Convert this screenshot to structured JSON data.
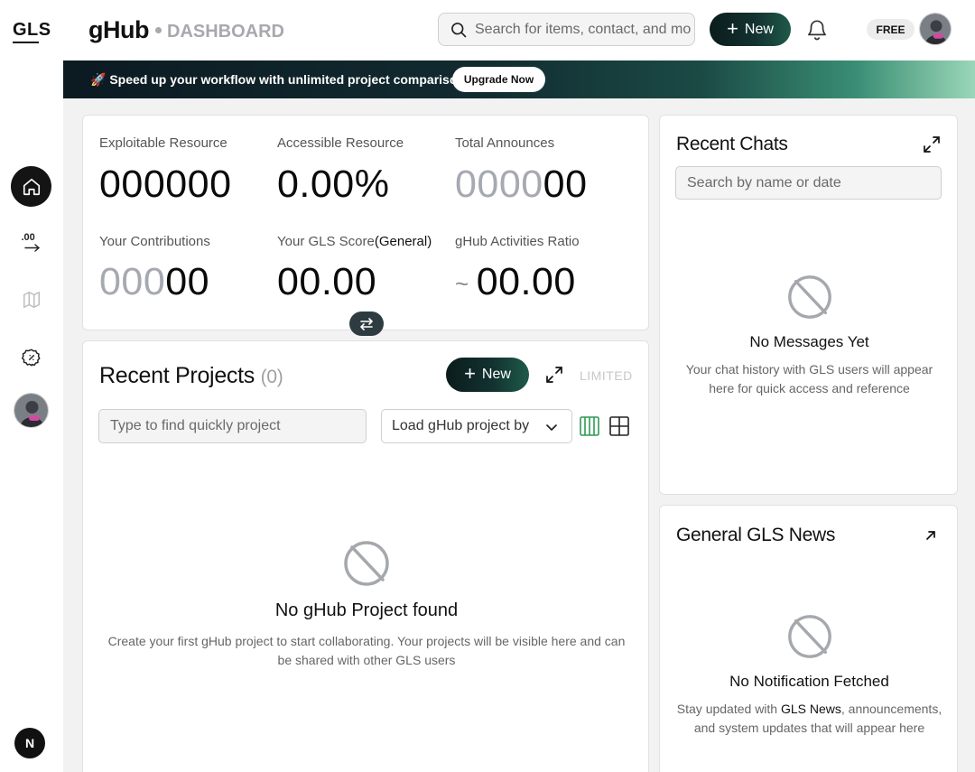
{
  "sidebar": {
    "logo": "GLS",
    "nav_counter": ".00",
    "bottom_badge": "N"
  },
  "header": {
    "brand": "gHub",
    "section": "DASHBOARD",
    "search_placeholder": "Search for items, contact, and more",
    "new_label": "New",
    "plan_badge": "FREE"
  },
  "banner": {
    "emoji": "🚀",
    "text": "Speed up your workflow with unlimited project comparisons",
    "button_label": "Upgrade Now"
  },
  "stats": {
    "exploitable": {
      "label": "Exploitable Resource",
      "value": "000000"
    },
    "accessible": {
      "label": "Accessible Resource",
      "value": "0.00%"
    },
    "announces": {
      "label": "Total Announces",
      "dim": "0000",
      "value": "00"
    },
    "contributions": {
      "label": "Your Contributions",
      "dim": "000",
      "value": "00"
    },
    "gls_score": {
      "label": "Your GLS Score",
      "label_suffix": "(General)",
      "value": "00.00"
    },
    "activities": {
      "label": "gHub Activities Ratio",
      "prefix": "~",
      "value": "00.00"
    }
  },
  "projects": {
    "title": "Recent Projects",
    "count": "(0)",
    "new_label": "New",
    "limited": "LIMITED",
    "search_placeholder": "Type to find quickly project",
    "load_select": "Load gHub project by",
    "empty_title": "No gHub Project found",
    "empty_desc": "Create your first gHub project to start collaborating. Your projects will be visible here and can be shared with other GLS users"
  },
  "chats": {
    "title": "Recent Chats",
    "search_placeholder": "Search by name or date",
    "empty_title": "No Messages Yet",
    "empty_desc": "Your chat history with GLS users will appear here for quick access and reference"
  },
  "news": {
    "title": "General GLS News",
    "empty_title": "No Notification Fetched",
    "desc_prefix": "Stay updated with ",
    "desc_highlight": "GLS News",
    "desc_suffix": ", announcements, and system updates that will appear here"
  },
  "colors": {
    "accent_dark": "#0b1c1c",
    "accent_green": "#1f5a49",
    "grid_active": "#2f9a55"
  }
}
